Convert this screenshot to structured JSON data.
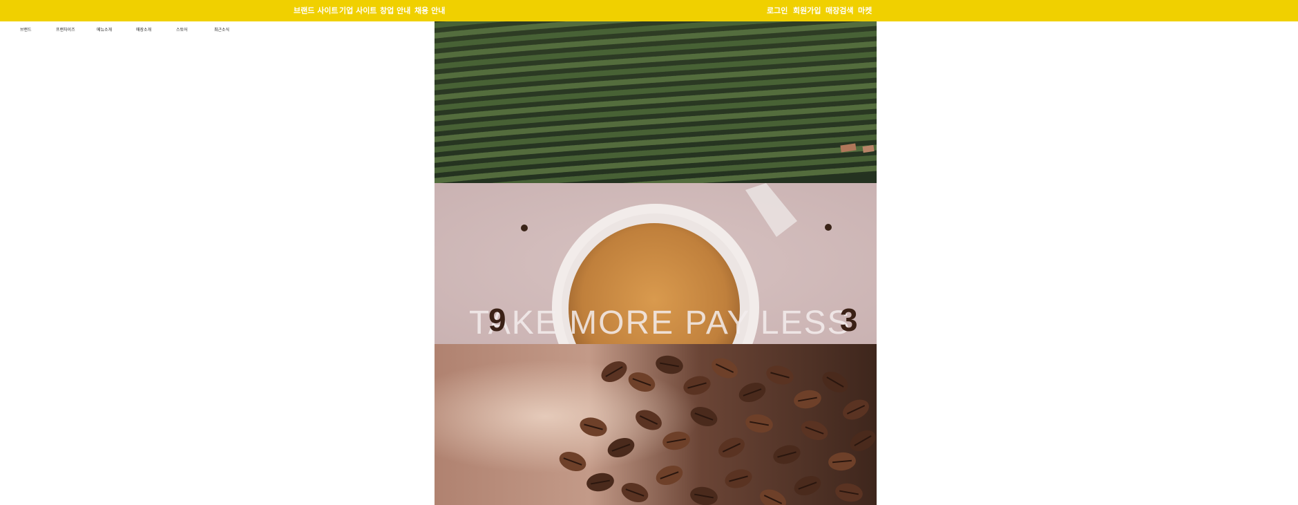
{
  "top_nav": {
    "left_links": [
      "브랜드 사이트",
      "기업 사이트",
      "창업 안내",
      "채용 안내"
    ],
    "right_links": [
      "로그인",
      "회원가입",
      "매장검색",
      "마켓"
    ]
  },
  "sub_nav": {
    "items": [
      "브랜드",
      "프랜차이즈",
      "메뉴소개",
      "매장소개",
      "스토어",
      "최근소식"
    ]
  },
  "hero": {
    "slogan": "TAKE MORE  PAY LESS",
    "badge_left": "9",
    "badge_right": "3"
  },
  "colors": {
    "top_bar": "#f0d000",
    "nav_text": "#ffffff"
  }
}
